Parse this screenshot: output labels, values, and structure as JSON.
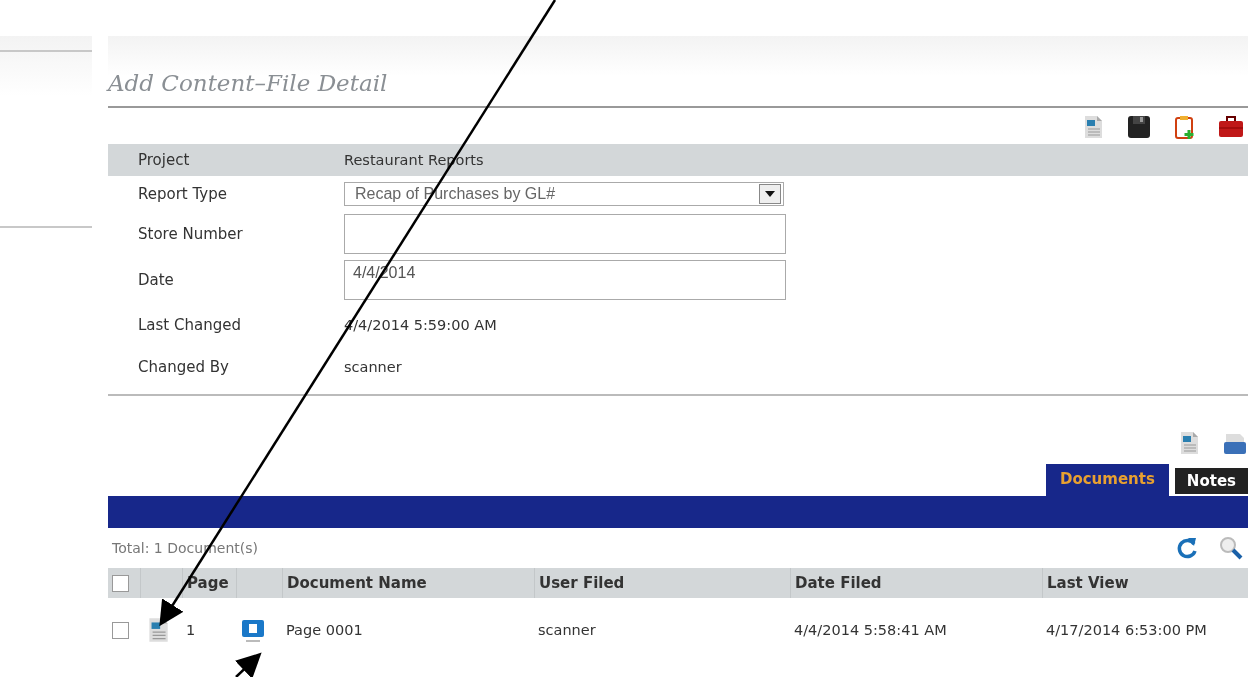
{
  "title": "Add Content–File Detail",
  "toolbar": [
    {
      "kind": "document"
    },
    {
      "kind": "save"
    },
    {
      "kind": "clipboard-add"
    },
    {
      "kind": "toolbox"
    }
  ],
  "fields": [
    {
      "kind": "text",
      "label": "Project",
      "value": "Restaurant Reports"
    },
    {
      "kind": "select",
      "label": "Report Type",
      "value": "Recap of Purchases by GL#"
    },
    {
      "kind": "input",
      "label": "Store Number"
    },
    {
      "kind": "input",
      "label": "Date",
      "value": "4/4/2014"
    },
    {
      "kind": "text",
      "label": "Last Changed",
      "value": "4/4/2014 5:59:00 AM"
    },
    {
      "kind": "text",
      "label": "Changed By",
      "value": "scanner"
    }
  ],
  "doc_toolbar": [
    {
      "kind": "document"
    },
    {
      "kind": "scanner"
    }
  ],
  "tabs": [
    {
      "label": "Documents",
      "selected": true
    },
    {
      "label": "Notes",
      "selected": false
    }
  ],
  "total": "Total: 1 Document(s)",
  "table": {
    "select_all": {
      "checked": false
    },
    "columns": [
      "Page",
      "Document Name",
      "User Filed",
      "Date Filed",
      "Last View"
    ],
    "rows": [
      {
        "checked": false,
        "page": "1",
        "name": "Page 0001",
        "user": "scanner",
        "date_filed": "4/4/2014 5:58:41 AM",
        "last_view": "4/17/2014 6:53:00 PM"
      }
    ]
  }
}
